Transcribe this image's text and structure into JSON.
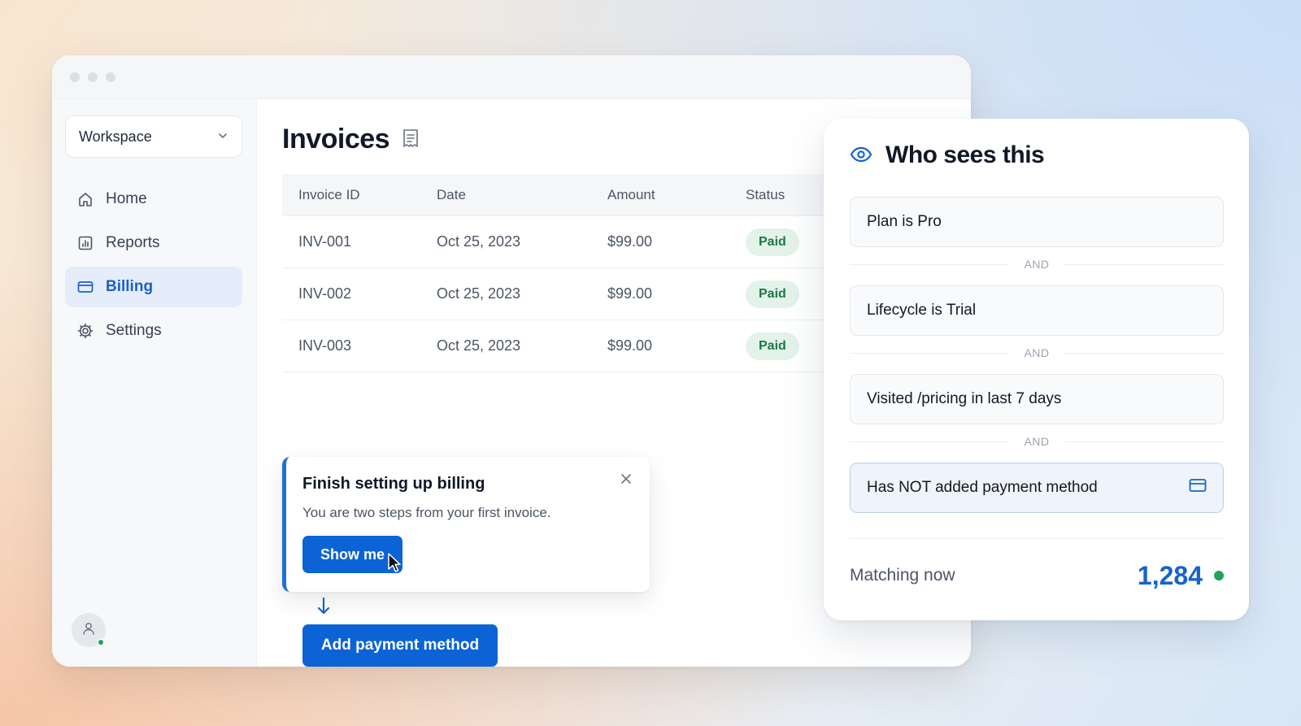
{
  "window": {
    "workspace_label": "Workspace",
    "nav": [
      {
        "label": "Home",
        "icon": "home-icon"
      },
      {
        "label": "Reports",
        "icon": "bar-chart-icon"
      },
      {
        "label": "Billing",
        "icon": "credit-card-icon",
        "active": true
      },
      {
        "label": "Settings",
        "icon": "gear-icon"
      }
    ]
  },
  "invoices": {
    "title": "Invoices",
    "columns": [
      "Invoice ID",
      "Date",
      "Amount",
      "Status"
    ],
    "rows": [
      {
        "id": "INV-001",
        "date": "Oct 25, 2023",
        "amount": "$99.00",
        "status": "Paid"
      },
      {
        "id": "INV-002",
        "date": "Oct 25, 2023",
        "amount": "$99.00",
        "status": "Paid"
      },
      {
        "id": "INV-003",
        "date": "Oct 25, 2023",
        "amount": "$99.00",
        "status": "Paid"
      }
    ]
  },
  "guide": {
    "title": "Finish setting up billing",
    "body": "You are two steps from your first invoice.",
    "cta": "Show me"
  },
  "add_payment_label": "Add payment method",
  "audience": {
    "title": "Who sees this",
    "conditions": [
      "Plan is Pro",
      "Lifecycle is Trial",
      "Visited /pricing in last 7 days",
      "Has NOT added payment method"
    ],
    "joiner": "AND",
    "matching_label": "Matching now",
    "matching_count": "1,284"
  },
  "colors": {
    "accent": "#0b63d6",
    "paid_badge_bg": "#e3f3e9",
    "paid_badge_text": "#1b7a43",
    "live_dot": "#22a35a"
  }
}
